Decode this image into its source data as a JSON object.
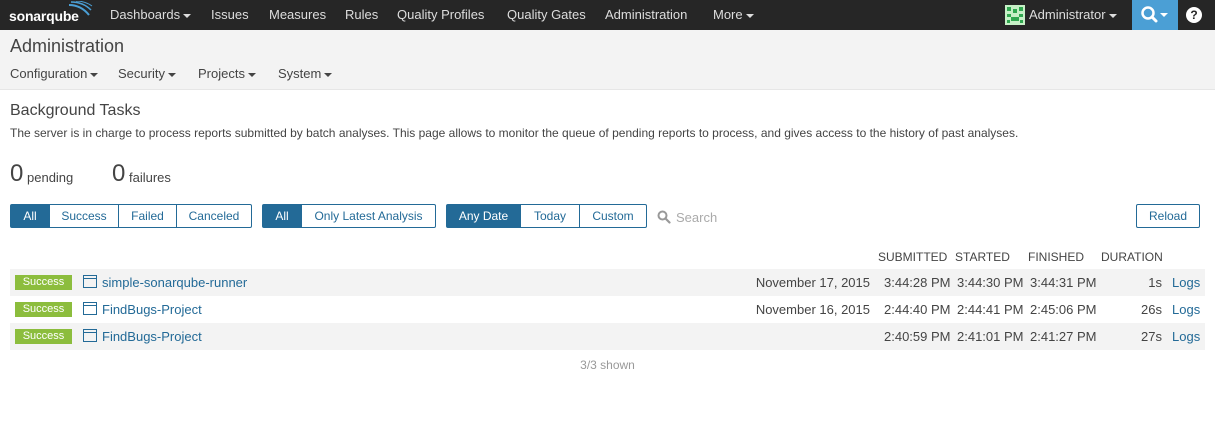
{
  "nav": {
    "logo": "sonarqube",
    "items": [
      {
        "label": "Dashboards",
        "dropdown": true
      },
      {
        "label": "Issues",
        "dropdown": false
      },
      {
        "label": "Measures",
        "dropdown": false
      },
      {
        "label": "Rules",
        "dropdown": false
      },
      {
        "label": "Quality Profiles",
        "dropdown": false
      },
      {
        "label": "Quality Gates",
        "dropdown": false
      },
      {
        "label": "Administration",
        "dropdown": false
      },
      {
        "label": "More",
        "dropdown": true
      }
    ],
    "user": "Administrator",
    "help": "?"
  },
  "admin": {
    "title": "Administration",
    "menu": [
      "Configuration",
      "Security",
      "Projects",
      "System"
    ]
  },
  "page": {
    "title": "Background Tasks",
    "description": "The server is in charge to process reports submitted by batch analyses. This page allows to monitor the queue of pending reports to process, and gives access to the history of past analyses."
  },
  "stats": {
    "pending": {
      "value": "0",
      "label": "pending"
    },
    "failures": {
      "value": "0",
      "label": "failures"
    }
  },
  "filters": {
    "status": [
      {
        "label": "All",
        "active": true
      },
      {
        "label": "Success",
        "active": false
      },
      {
        "label": "Failed",
        "active": false
      },
      {
        "label": "Canceled",
        "active": false
      }
    ],
    "type": [
      {
        "label": "All",
        "active": true
      },
      {
        "label": "Only Latest Analysis",
        "active": false
      }
    ],
    "date": [
      {
        "label": "Any Date",
        "active": true
      },
      {
        "label": "Today",
        "active": false
      },
      {
        "label": "Custom",
        "active": false
      }
    ],
    "search_placeholder": "Search",
    "reload_label": "Reload"
  },
  "table": {
    "headers": [
      "SUBMITTED",
      "STARTED",
      "FINISHED",
      "DURATION"
    ],
    "rows": [
      {
        "status": "Success",
        "project": "simple-sonarqube-runner",
        "date": "November 17, 2015",
        "submitted": "3:44:28 PM",
        "started": "3:44:30 PM",
        "finished": "3:44:31 PM",
        "duration": "1s",
        "logs": "Logs"
      },
      {
        "status": "Success",
        "project": "FindBugs-Project",
        "date": "November 16, 2015",
        "submitted": "2:44:40 PM",
        "started": "2:44:41 PM",
        "finished": "2:45:06 PM",
        "duration": "26s",
        "logs": "Logs"
      },
      {
        "status": "Success",
        "project": "FindBugs-Project",
        "date": "",
        "submitted": "2:40:59 PM",
        "started": "2:41:01 PM",
        "finished": "2:41:27 PM",
        "duration": "27s",
        "logs": "Logs"
      }
    ],
    "footer": "3/3 shown"
  },
  "colors": {
    "nav_bg": "#262626",
    "accent": "#236a97",
    "search_btn": "#4b9fd5",
    "success": "#8cbd3d"
  }
}
